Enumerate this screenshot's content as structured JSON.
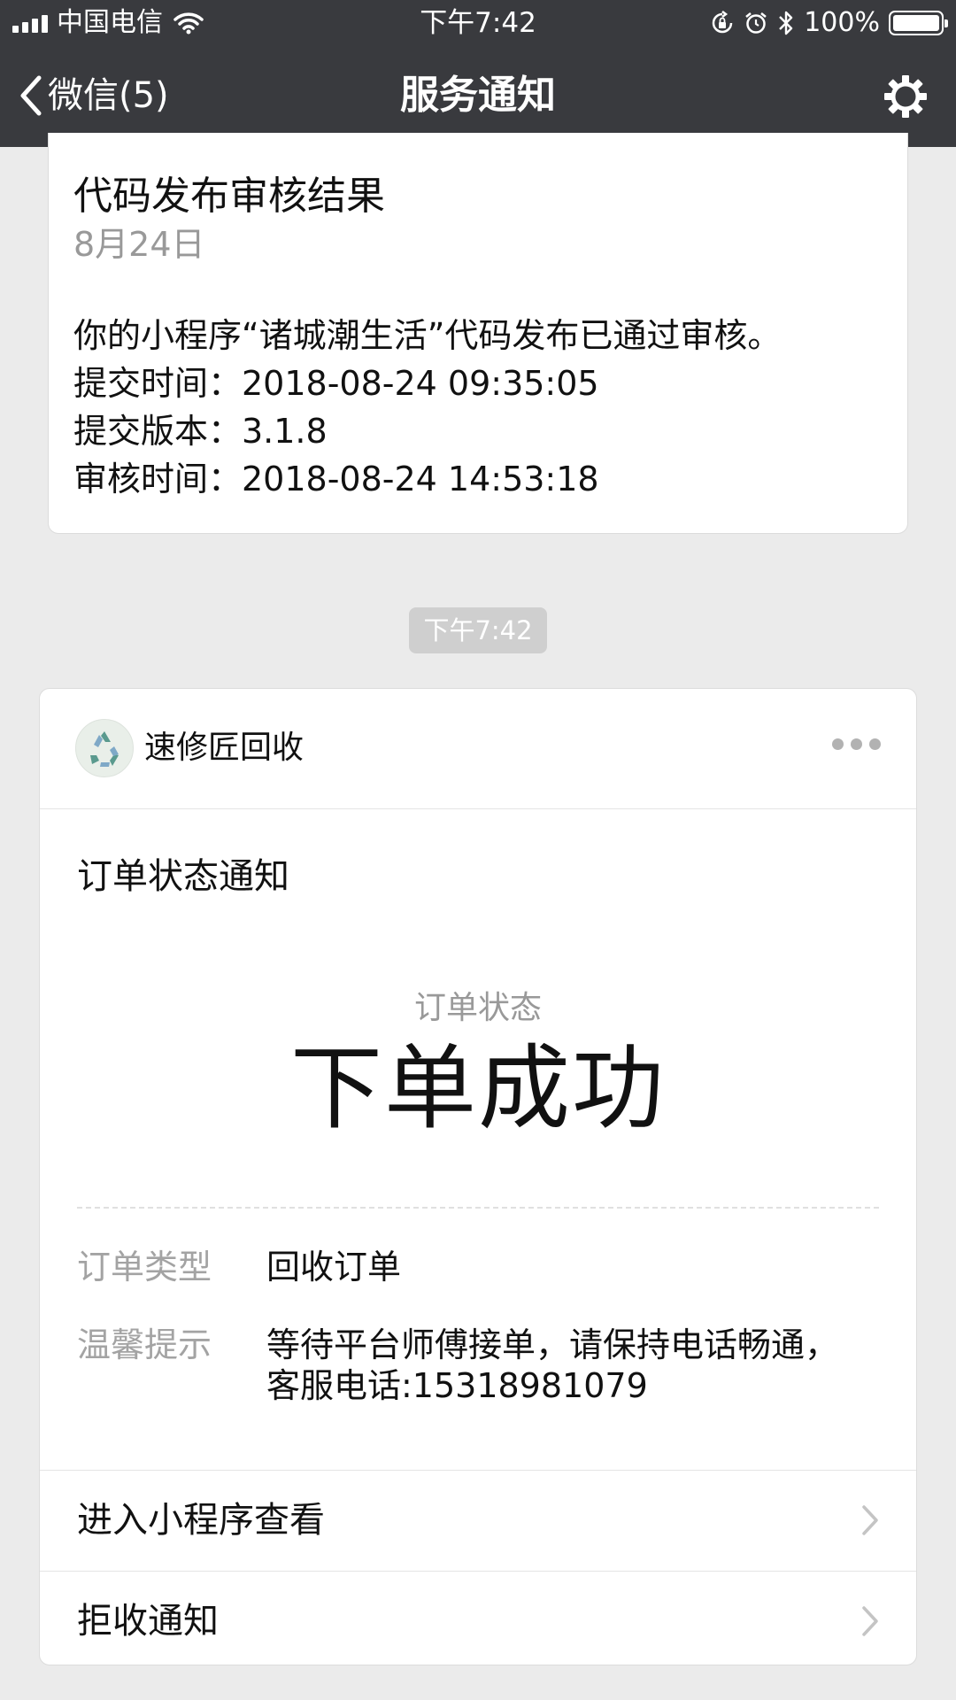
{
  "status_bar": {
    "carrier": "中国电信",
    "time": "下午7:42",
    "battery_percent": "100%",
    "battery_level": 1.0
  },
  "nav": {
    "back_label": "微信(5)",
    "title": "服务通知"
  },
  "card1": {
    "title": "代码发布审核结果",
    "date": "8月24日",
    "lines": [
      "你的小程序“诸城潮生活”代码发布已通过审核。",
      "提交时间：2018-08-24 09:35:05",
      "提交版本：3.1.8",
      "审核时间：2018-08-24 14:53:18"
    ]
  },
  "timestamp": "下午7:42",
  "card2": {
    "app_name": "速修匠回收",
    "title": "订单状态通知",
    "status_label": "订单状态",
    "status_value": "下单成功",
    "fields": [
      {
        "key": "订单类型",
        "value": "回收订单"
      },
      {
        "key": "温馨提示",
        "value_lines": [
          "等待平台师傅接单，请保持电话畅通，",
          "客服电话:15318981079"
        ]
      }
    ],
    "links": [
      {
        "label": "进入小程序查看"
      },
      {
        "label": "拒收通知"
      }
    ]
  },
  "colors": {
    "nav_bg": "#393a3e",
    "page_bg": "#ebebeb",
    "secondary_text": "#999999"
  },
  "icons": [
    "signal-icon",
    "wifi-icon",
    "rotation-lock-icon",
    "alarm-icon",
    "bluetooth-icon",
    "battery-icon",
    "back-chevron-icon",
    "gear-icon",
    "recycle-icon",
    "more-icon",
    "chevron-right-icon"
  ]
}
